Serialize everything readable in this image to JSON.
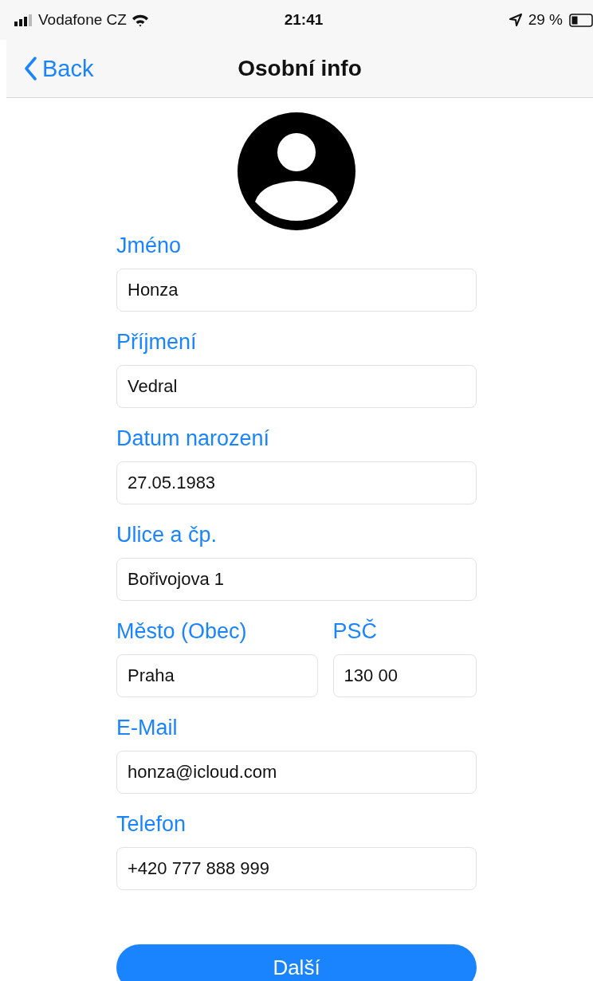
{
  "status_bar": {
    "carrier": "Vodafone CZ",
    "time": "21:41",
    "battery": "29 %"
  },
  "nav": {
    "back": "Back",
    "title": "Osobní info"
  },
  "rows": [
    {
      "fields": [
        {
          "label": "Jméno",
          "value": "Honza"
        }
      ]
    },
    {
      "fields": [
        {
          "label": "Příjmení",
          "value": "Vedral"
        }
      ]
    },
    {
      "fields": [
        {
          "label": "Datum narození",
          "value": "27.05.1983"
        }
      ]
    },
    {
      "fields": [
        {
          "label": "Ulice a čp.",
          "value": "Bořivojova 1"
        }
      ]
    },
    {
      "fields": [
        {
          "label": "Město (Obec)",
          "value": "Praha"
        },
        {
          "label": "PSČ",
          "value": "130 00"
        }
      ]
    },
    {
      "fields": [
        {
          "label": "E-Mail",
          "value": "honza@icloud.com"
        }
      ]
    },
    {
      "fields": [
        {
          "label": "Telefon",
          "value": "+420 777 888 999"
        }
      ]
    }
  ],
  "next_button": "Další"
}
